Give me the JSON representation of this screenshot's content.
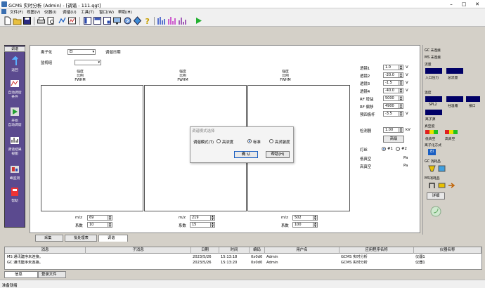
{
  "window": {
    "title": "GCMS 实时分析 (Admin) - [调谐 - 111.qgt]"
  },
  "menu": [
    "文件(F)",
    "视图(V)",
    "仪器(I)",
    "调谐(U)",
    "工具(T)",
    "窗口(W)",
    "帮助(H)"
  ],
  "leftnav": {
    "header": "调谐",
    "items": [
      {
        "label": "返回",
        "icon": "back-arrow-icon"
      },
      {
        "label": "自动调谐\n条件",
        "icon": "tune-settings-icon"
      },
      {
        "label": "开始\n自动调谐",
        "icon": "start-icon"
      },
      {
        "label": "调谐结果\n视图",
        "icon": "results-view-icon"
      },
      {
        "label": "峰监测",
        "icon": "peak-monitor-icon"
      },
      {
        "label": "帮助",
        "icon": "help-icon"
      }
    ]
  },
  "main": {
    "ionization_label": "离子化",
    "ionization_value": "EI",
    "tune_date_label": "调谐日期",
    "monitor_group_label": "监视组",
    "graph_header": [
      "强度",
      "比例",
      "FWHM"
    ],
    "graphs": [
      {
        "mz_label": "m/z",
        "mz": "69",
        "coef_label": "系数",
        "coef": "10"
      },
      {
        "mz_label": "m/z",
        "mz": "219",
        "coef_label": "系数",
        "coef": "15"
      },
      {
        "mz_label": "m/z",
        "mz": "502",
        "coef_label": "系数",
        "coef": "100"
      }
    ],
    "params": [
      {
        "label": "透镜1",
        "value": "1.0",
        "unit": "V"
      },
      {
        "label": "透镜2",
        "value": "-20.0",
        "unit": "V"
      },
      {
        "label": "透镜3",
        "value": "-1.5",
        "unit": "V"
      },
      {
        "label": "透镜4",
        "value": "-40.0",
        "unit": "V"
      },
      {
        "label": "RF 增益",
        "value": "5000",
        "unit": ""
      },
      {
        "label": "RF 偏移",
        "value": "4900",
        "unit": ""
      },
      {
        "label": "预四极杆",
        "value": "-3.5",
        "unit": "V"
      }
    ],
    "detector_label": "检测器",
    "detector_value": "1.00",
    "detector_unit": "kV",
    "advanced_label": "高级",
    "filament_label": "灯丝",
    "filament_options": [
      "#1",
      "#2"
    ],
    "low_vacuum_label": "低真空",
    "low_vacuum_unit": "Pa",
    "high_vacuum_label": "高真空",
    "high_vacuum_unit": "Pa"
  },
  "tabs": [
    "采集",
    "批处理表",
    "调谐"
  ],
  "modal": {
    "title": "调谐模式选择",
    "mode_label": "调谐模式(T)",
    "options": [
      "高浓度",
      "标准",
      "高灵敏度"
    ],
    "selected": "标准",
    "ok": "确 认",
    "help": "帮助(H)"
  },
  "rightpanel": {
    "gc_status": "GC 未连接",
    "ms_status": "MS 未连接",
    "flow_label": "流量",
    "flow_items": [
      "入口压力",
      "总流量"
    ],
    "temp_label": "温度",
    "temp_items": [
      "SPL2",
      "柱温箱",
      "接口"
    ],
    "ion_source": "离子源",
    "vacuum_label": "真空度",
    "vacuum_items": [
      "低真空",
      "高真空"
    ],
    "ionization_mode_label": "离子化方式",
    "ionization_mode": "EI",
    "gc_consumables": "GC 消耗品",
    "ms_consumables": "MS消耗品",
    "detail_button": "详细"
  },
  "log": {
    "headers": [
      "消息",
      "子消息",
      "日期",
      "时间",
      "编码",
      "用户名",
      "应用程序名称",
      "仪器名称"
    ],
    "rows": [
      [
        "MS 通讯建序未连接。",
        "",
        "2023/5/26",
        "15:13:18",
        "0x0d0",
        "Admin",
        "GCMS 实时分析",
        "仪器1"
      ],
      [
        "GC 通讯建序未连接。",
        "",
        "2023/5/26",
        "15:13:20",
        "0x0d0",
        "Admin",
        "GCMS 实时分析",
        "仪器1"
      ]
    ],
    "tabs": [
      "信息",
      "登录文件"
    ]
  },
  "statusbar": {
    "text": "准备就绪"
  },
  "colors": {
    "nav_bg": "#5b4a8f",
    "navy": "#000066",
    "accent": "#1b5fc2"
  }
}
